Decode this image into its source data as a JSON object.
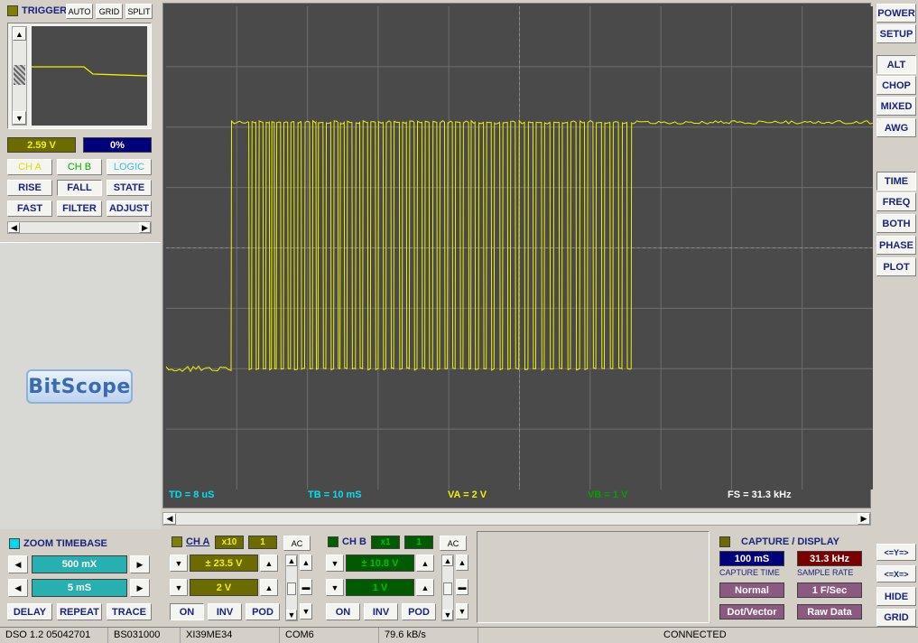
{
  "trigger": {
    "title": "TRIGGER",
    "auto": "AUTO",
    "grid": "GRID",
    "split": "SPLIT",
    "level": "2.59 V",
    "position": "0%",
    "ch_a": "CH A",
    "ch_b": "CH B",
    "logic": "LOGIC",
    "rise": "RISE",
    "fall": "FALL",
    "state": "STATE",
    "fast": "FAST",
    "filter": "FILTER",
    "adjust": "ADJUST"
  },
  "logo": "BitScope",
  "zoom": {
    "title": "ZOOM TIMEBASE",
    "zoom_value": "500 mX",
    "time_value": "5 mS",
    "delay": "DELAY",
    "repeat": "REPEAT",
    "trace": "TRACE"
  },
  "scope": {
    "td": "TD = 8 uS",
    "tb": "TB = 10 mS",
    "va": "VA = 2 V",
    "vb": "VB = 1 V",
    "fs": "FS = 31.3 kHz"
  },
  "cha": {
    "title": "CH A",
    "probe": "x10",
    "num": "1",
    "coupling": "AC",
    "range": "± 23.5 V",
    "div": "2 V",
    "on": "ON",
    "inv": "INV",
    "pod": "POD"
  },
  "chb": {
    "title": "CH B",
    "probe": "x1",
    "num": "1",
    "coupling": "AC",
    "range": "± 10.8 V",
    "div": "1 V",
    "on": "ON",
    "inv": "INV",
    "pod": "POD"
  },
  "capture": {
    "title": "CAPTURE / DISPLAY",
    "capture_time": "100 mS",
    "capture_time_label": "CAPTURE TIME",
    "sample_rate": "31.3 kHz",
    "sample_rate_label": "SAMPLE RATE",
    "mode": "Normal",
    "fps": "1 F/Sec",
    "draw": "Dot/Vector",
    "data": "Raw Data"
  },
  "right": {
    "power": "POWER",
    "setup": "SETUP",
    "alt": "ALT",
    "chop": "CHOP",
    "mixed": "MIXED",
    "awg": "AWG",
    "time": "TIME",
    "freq": "FREQ",
    "both": "BOTH",
    "phase": "PHASE",
    "plot": "PLOT",
    "ybtn": "<=Y=>",
    "xbtn": "<=X=>",
    "hide": "HIDE",
    "grid": "GRID"
  },
  "status": {
    "version": "DSO 1.2 05042701",
    "model": "BS031000",
    "id": "XI39ME34",
    "port": "COM6",
    "rate": "79.6 kB/s",
    "state": "CONNECTED"
  },
  "colors": {
    "trace": "#f0f000",
    "screen": "#4a4a4a",
    "grid": "#6e6e6e",
    "td": "#00e0f0",
    "va": "#f0f000",
    "vb": "#00a000",
    "fs": "#ffffff"
  },
  "waveform": {
    "high_level": 0.76,
    "low_level": 0.25,
    "start_fraction": 0.092,
    "end_fraction": 0.658,
    "edges": [
      0.092,
      0.117,
      0.121,
      0.127,
      0.131,
      0.137,
      0.141,
      0.146,
      0.149,
      0.153,
      0.156,
      0.162,
      0.166,
      0.172,
      0.176,
      0.181,
      0.186,
      0.191,
      0.196,
      0.203,
      0.207,
      0.212,
      0.215,
      0.222,
      0.226,
      0.233,
      0.237,
      0.243,
      0.246,
      0.252,
      0.256,
      0.263,
      0.268,
      0.274,
      0.278,
      0.285,
      0.289,
      0.296,
      0.3,
      0.307,
      0.311,
      0.318,
      0.322,
      0.33,
      0.334,
      0.34,
      0.344,
      0.351,
      0.355,
      0.362,
      0.366,
      0.372,
      0.377,
      0.383,
      0.387,
      0.394,
      0.398,
      0.405,
      0.409,
      0.416,
      0.42,
      0.428,
      0.431,
      0.437,
      0.442,
      0.449,
      0.453,
      0.46,
      0.464,
      0.472,
      0.476,
      0.483,
      0.487,
      0.494,
      0.499,
      0.507,
      0.512,
      0.519,
      0.523,
      0.531,
      0.535,
      0.543,
      0.548,
      0.556,
      0.56,
      0.568,
      0.572,
      0.58,
      0.585,
      0.592,
      0.596,
      0.604,
      0.608,
      0.616,
      0.62,
      0.628,
      0.632,
      0.64,
      0.645,
      0.652,
      0.658
    ]
  }
}
